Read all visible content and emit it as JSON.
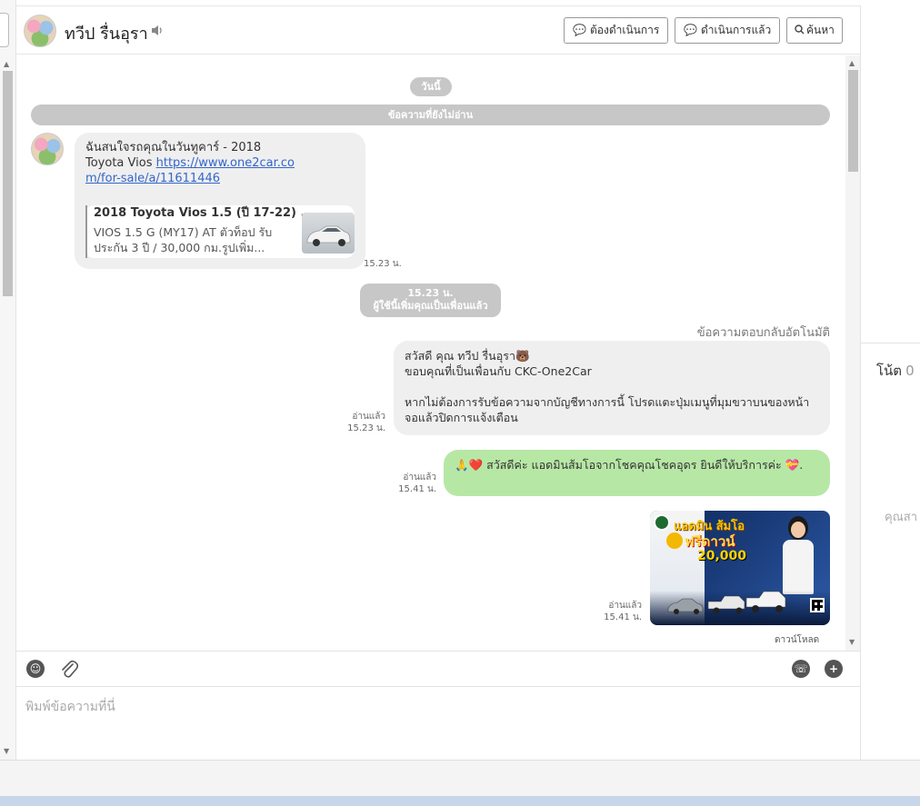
{
  "header": {
    "contact_name": "ทวีป รื่นอุรา",
    "btn_todo": "ต้องดำเนินการ",
    "btn_done": "ดำเนินการแล้ว",
    "btn_search": "ค้นหา"
  },
  "messages": {
    "date_pill": "วันนี้",
    "unread_banner": "ข้อความที่ยังไม่อ่าน",
    "incoming": {
      "text": "ฉันสนใจรถคุณในวันทูคาร์ - 2018 Toyota Vios ",
      "link": "https://www.one2car.com/for-sale/a/11611446",
      "card_title": "2018 Toyota Vios 1.5 (ปี 17-22) ...",
      "card_desc": "VIOS 1.5 G (MY17) AT ตัวท็อป รับประกัน 3 ปี / 30,000 กม.รูปเพิ่ม...",
      "time": "15.23 น."
    },
    "system_event": {
      "time": "15.23 น.",
      "text": "ผู้ใช้นี้เพิ่มคุณเป็นเพื่อนแล้ว"
    },
    "auto_reply_label": "ข้อความตอบกลับอัตโนมัติ",
    "auto_reply": {
      "line1": "สวัสดี คุณ ทวีป รื่นอุรา🐻",
      "line2": "ขอบคุณที่เป็นเพื่อนกับ CKC-One2Car",
      "line3": "หากไม่ต้องการรับข้อความจากบัญชีทางการนี้ โปรดแตะปุ่มเมนูที่มุมขวาบนของหน้าจอแล้วปิดการแจ้งเตือน",
      "read": "อ่านแล้ว",
      "time": "15.23 น."
    },
    "greeting": {
      "text": "🙏❤️ สวัสดีค่ะ แอดมินส้มโอจากโชคคุณโชคอุดร ยินดีให้บริการค่ะ 💝.",
      "read": "อ่านแล้ว",
      "time": "15.41 น."
    },
    "promo": {
      "headline": "แอดมิน ส้มโอ",
      "badge": "ฟรีดาวน์",
      "amount": "20,000",
      "read": "อ่านแล้ว",
      "time": "15.41 น.",
      "download": "ดาวน์โหลด"
    }
  },
  "composer": {
    "placeholder": "พิมพ์ข้อความที่นี่"
  },
  "right_panel": {
    "note_label": "โน้ต",
    "note_count": "0",
    "hint": "คุณสา"
  },
  "colors": {
    "bubble_incoming": "#efefef",
    "bubble_green": "#b7e7a5",
    "pill": "#c7c7c7",
    "link": "#3366cc"
  }
}
